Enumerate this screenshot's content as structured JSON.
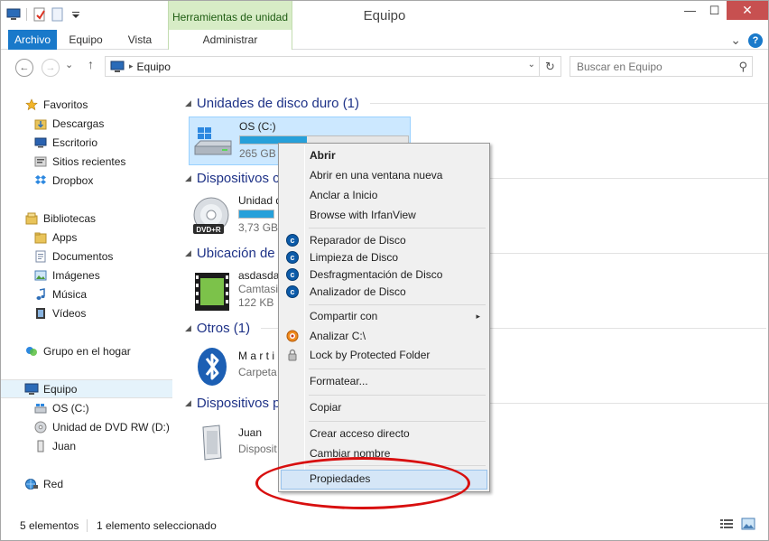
{
  "window": {
    "title": "Equipo",
    "context_tab_group": "Herramientas de unidad",
    "controls": {
      "minimize": "—",
      "maximize": "☐",
      "close": "✕"
    }
  },
  "ribbon": {
    "tabs": [
      {
        "label": "Archivo"
      },
      {
        "label": "Equipo"
      },
      {
        "label": "Vista"
      },
      {
        "label": "Administrar"
      }
    ],
    "collapse": "⌄",
    "help": "?"
  },
  "address": {
    "path": "Equipo",
    "separator": "▸",
    "dropdown": "⌄",
    "refresh": "↻"
  },
  "search": {
    "placeholder": "Buscar en Equipo",
    "icon": "search-icon"
  },
  "navpane": {
    "items": [
      {
        "label": "Favoritos",
        "icon": "star-icon"
      },
      {
        "label": "Descargas",
        "icon": "folder-download-icon"
      },
      {
        "label": "Escritorio",
        "icon": "desktop-icon"
      },
      {
        "label": "Sitios recientes",
        "icon": "recent-icon"
      },
      {
        "label": "Dropbox",
        "icon": "dropbox-icon"
      },
      {
        "label": "Bibliotecas",
        "icon": "libraries-icon"
      },
      {
        "label": "Apps",
        "icon": "folder-icon"
      },
      {
        "label": "Documentos",
        "icon": "documents-icon"
      },
      {
        "label": "Imágenes",
        "icon": "pictures-icon"
      },
      {
        "label": "Música",
        "icon": "music-icon"
      },
      {
        "label": "Vídeos",
        "icon": "videos-icon"
      },
      {
        "label": "Grupo en el hogar",
        "icon": "homegroup-icon"
      },
      {
        "label": "Equipo",
        "icon": "computer-icon"
      },
      {
        "label": "OS (C:)",
        "icon": "drive-icon"
      },
      {
        "label": "Unidad de DVD RW (D:) 2",
        "icon": "dvd-icon"
      },
      {
        "label": "Juan",
        "icon": "device-icon"
      },
      {
        "label": "Red",
        "icon": "network-icon"
      }
    ]
  },
  "content": {
    "groups": [
      {
        "label": "Unidades de disco duro (1)"
      },
      {
        "label": "Dispositivos co"
      },
      {
        "label": "Ubicación de r"
      },
      {
        "label": "Otros (1)"
      },
      {
        "label": "Dispositivos p"
      }
    ],
    "tiles": [
      {
        "title": "OS (C:)",
        "sub": "265 GB d",
        "fill": 0.4
      },
      {
        "title": "Unidad d",
        "sub": "3,73 GB",
        "fill": 0.45
      },
      {
        "title": "asdasda",
        "sub": "Camtasi",
        "sub2": "122 KB"
      },
      {
        "title": "M a r t i",
        "sub": "Carpeta"
      },
      {
        "title": "Juan",
        "sub": "Disposit"
      }
    ],
    "dvd_label": "DVD+R"
  },
  "context_menu": {
    "items": [
      {
        "label": "Abrir",
        "bold": true
      },
      {
        "label": "Abrir en una ventana nueva"
      },
      {
        "label": "Anclar a Inicio"
      },
      {
        "label": "Browse with IrfanView"
      },
      {
        "label": "Reparador de Disco",
        "icon": "c"
      },
      {
        "label": "Limpieza de Disco",
        "icon": "c"
      },
      {
        "label": "Desfragmentación de Disco",
        "icon": "c"
      },
      {
        "label": "Analizador de Disco",
        "icon": "c"
      },
      {
        "label": "Compartir con",
        "submenu": "▸"
      },
      {
        "label": "Analizar C:\\"
      },
      {
        "label": "Lock by Protected Folder"
      },
      {
        "label": "Formatear..."
      },
      {
        "label": "Copiar"
      },
      {
        "label": "Crear acceso directo"
      },
      {
        "label": "Cambiar nombre"
      },
      {
        "label": "Propiedades",
        "highlighted": true
      }
    ]
  },
  "status": {
    "count": "5 elementos",
    "selection": "1 elemento seleccionado"
  },
  "colors": {
    "accent": "#1979ca",
    "context_tab": "#d7ecc6",
    "selection": "#cce8ff",
    "annotation": "#d80f0f",
    "group_header": "#1e3287"
  }
}
